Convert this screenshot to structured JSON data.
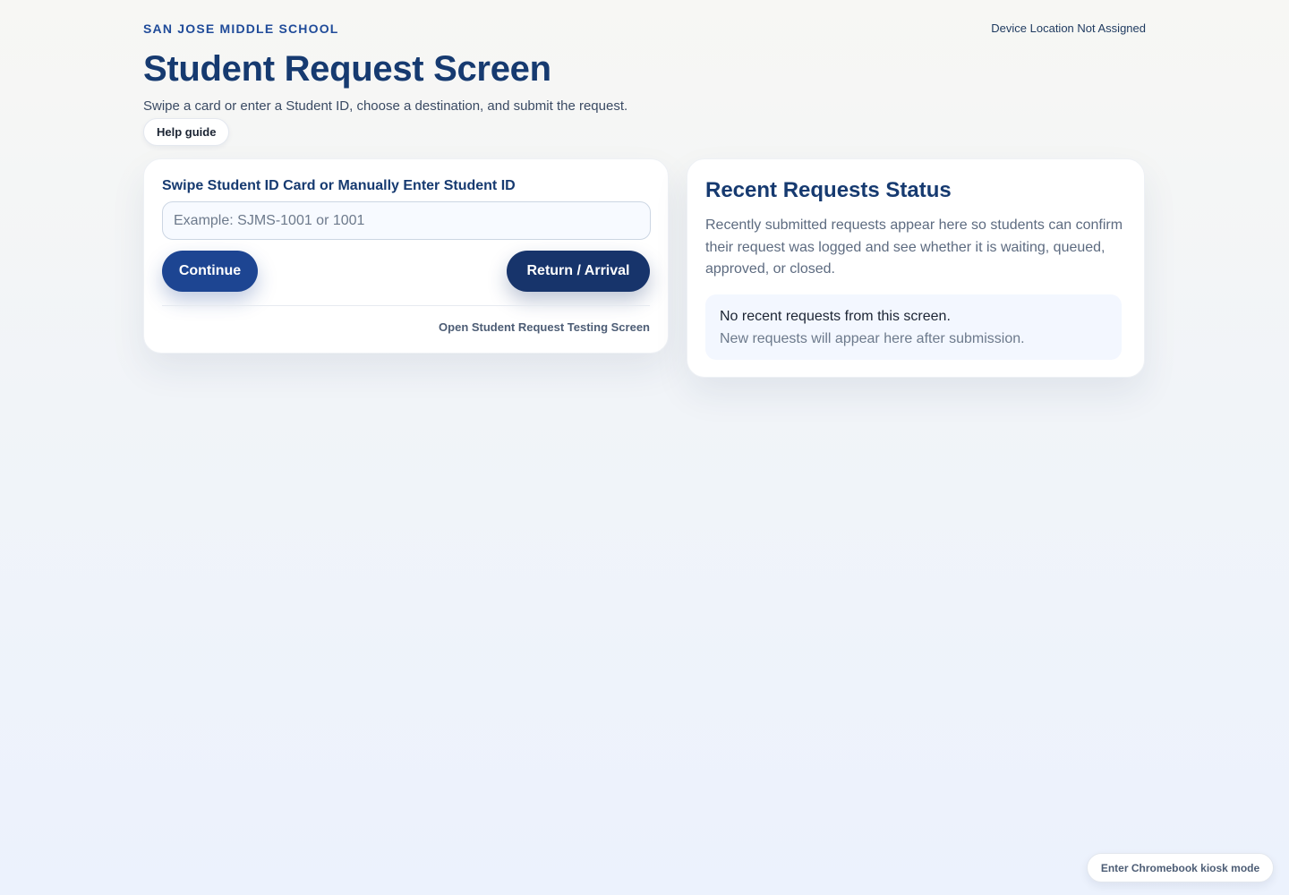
{
  "header": {
    "school_name": "SAN JOSE MIDDLE SCHOOL",
    "device_status": "Device Location Not Assigned",
    "title": "Student Request Screen",
    "subtitle": "Swipe a card or enter a Student ID, choose a destination, and submit the request.",
    "help_label": "Help guide"
  },
  "request_form": {
    "field_label": "Swipe Student ID Card or Manually Enter Student ID",
    "input_value": "",
    "input_placeholder": "Example: SJMS-1001 or 1001",
    "continue_label": "Continue",
    "return_label": "Return / Arrival",
    "testing_link": "Open Student Request Testing Screen"
  },
  "recent_requests": {
    "title": "Recent Requests Status",
    "description": "Recently submitted requests appear here so students can confirm their request was logged and see whether it is waiting, queued, approved, or closed.",
    "empty_title": "No recent requests from this screen.",
    "empty_subtitle": "New requests will appear here after submission."
  },
  "footer": {
    "kiosk_label": "Enter Chromebook kiosk mode"
  },
  "colors": {
    "primary_navy": "#163a70",
    "button_blue": "#1d4592",
    "button_navy": "#17346b",
    "panel_bg": "#f3f7ff"
  }
}
